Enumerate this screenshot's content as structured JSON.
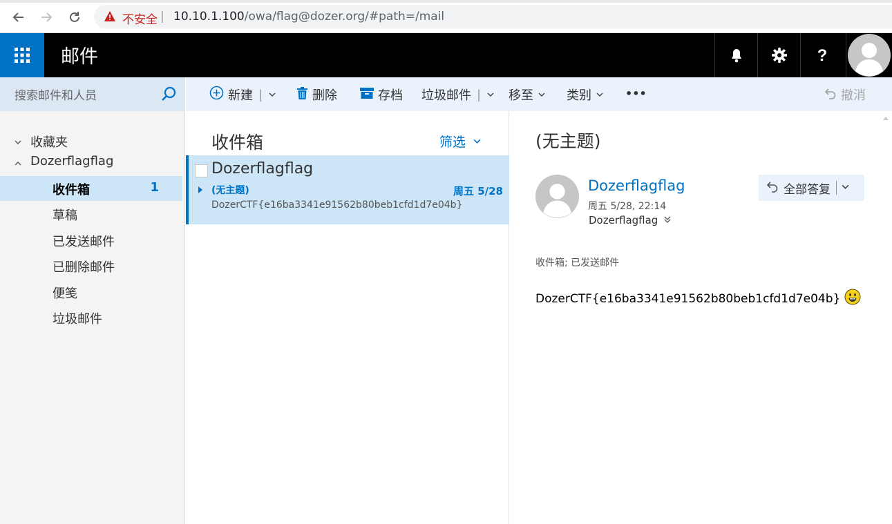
{
  "browser": {
    "insecure_label": "不安全",
    "separator": "|",
    "url_host": "10.10.1.100",
    "url_path": "/owa/flag@dozer.org/#path=/mail"
  },
  "header": {
    "app_title": "邮件"
  },
  "search": {
    "placeholder": "搜索邮件和人员"
  },
  "sidebar": {
    "favorites_label": "收藏夹",
    "account_label": "Dozerflagflag",
    "folders": [
      {
        "label": "收件箱",
        "count": "1"
      },
      {
        "label": "草稿"
      },
      {
        "label": "已发送邮件"
      },
      {
        "label": "已删除邮件"
      },
      {
        "label": "便笺"
      },
      {
        "label": "垃圾邮件"
      }
    ]
  },
  "toolbar": {
    "new_label": "新建",
    "delete_label": "删除",
    "archive_label": "存档",
    "junk_label": "垃圾邮件",
    "move_label": "移至",
    "category_label": "类别",
    "more_label": "•••",
    "undo_label": "撤消"
  },
  "message_list": {
    "title": "收件箱",
    "filter_label": "筛选",
    "items": [
      {
        "sender": "Dozerflagflag",
        "subject": "(无主题)",
        "date": "周五 5/28",
        "preview": "DozerCTF{e16ba3341e91562b80beb1cfd1d7e04b}"
      }
    ]
  },
  "reading_pane": {
    "subject": "(无主题)",
    "sender": "Dozerflagflag",
    "sent_time": "周五 5/28, 22:14",
    "to": "Dozerflagflag",
    "reply_all_label": "全部答复",
    "folders": "收件箱; 已发送邮件",
    "body": "DozerCTF{e16ba3341e91562b80beb1cfd1d7e04b}"
  },
  "colors": {
    "accent": "#0072c6",
    "selected_bg": "#cde6f7",
    "toolbar_bg": "#eaf3fb",
    "header_bg": "#000000",
    "insecure": "#c5221f"
  }
}
